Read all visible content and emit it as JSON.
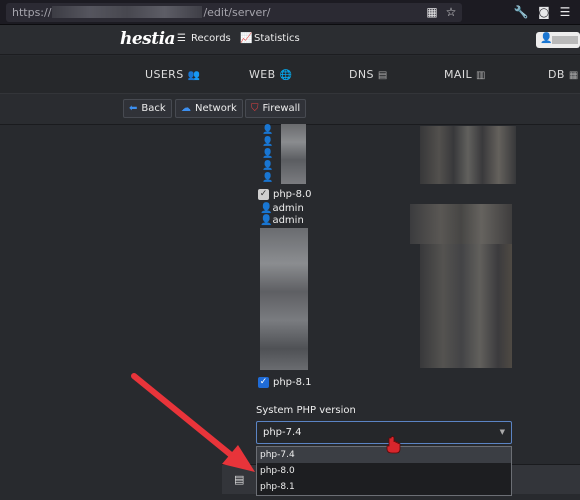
{
  "browser": {
    "url_prefix": "https://",
    "url_suffix": "/edit/server/",
    "icons": [
      "qr-code-icon",
      "star-icon",
      "wrench-icon",
      "pocket-icon",
      "menu-icon"
    ]
  },
  "nav": {
    "logo": "hestia",
    "records": "Records",
    "statistics": "Statistics"
  },
  "tabs": [
    {
      "label": "USERS",
      "icon": "users-icon"
    },
    {
      "label": "WEB",
      "icon": "globe-icon"
    },
    {
      "label": "DNS",
      "icon": "book-icon"
    },
    {
      "label": "MAIL",
      "icon": "mail-server-icon"
    },
    {
      "label": "DB",
      "icon": "database-icon"
    }
  ],
  "toolbar": {
    "back": "Back",
    "network": "Network",
    "firewall": "Firewall"
  },
  "php": {
    "php80_label": "php-8.0",
    "php80_checked": false,
    "users": [
      "admin",
      "admin"
    ],
    "php81_label": "php-8.1",
    "php81_checked": true
  },
  "system_php": {
    "label": "System PHP version",
    "selected": "php-7.4",
    "options": [
      "php-7.4",
      "php-8.0",
      "php-8.1"
    ]
  },
  "colors": {
    "accent": "#1f6bd6",
    "annotation_arrow": "#e8343a"
  }
}
